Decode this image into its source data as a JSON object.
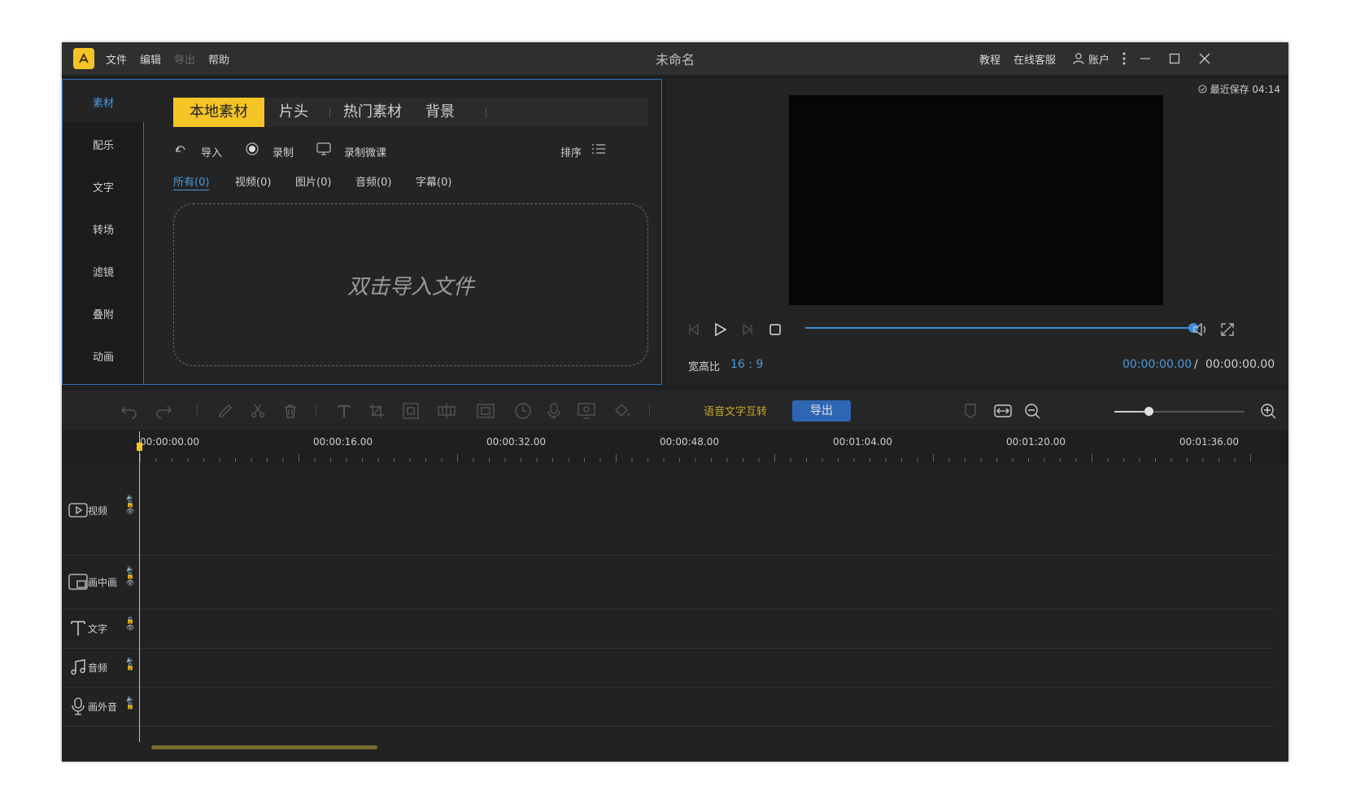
{
  "titlebar": {
    "menu": [
      "文件",
      "编辑",
      "导出",
      "帮助"
    ],
    "title": "未命名",
    "tutorial": "教程",
    "service": "在线客服",
    "account": "账户"
  },
  "sidebar": {
    "items": [
      {
        "label": "素材"
      },
      {
        "label": "配乐"
      },
      {
        "label": "文字"
      },
      {
        "label": "转场"
      },
      {
        "label": "滤镜"
      },
      {
        "label": "叠附"
      },
      {
        "label": "动画"
      }
    ]
  },
  "media": {
    "tabs": [
      {
        "label": "本地素材"
      },
      {
        "label": "片头"
      },
      {
        "label": "热门素材"
      },
      {
        "label": "背景"
      }
    ],
    "import_label": "导入",
    "record_label": "录制",
    "record_course_label": "录制微课",
    "sort_label": "排序",
    "filters": [
      {
        "label": "所有(0)"
      },
      {
        "label": "视频(0)"
      },
      {
        "label": "图片(0)"
      },
      {
        "label": "音频(0)"
      },
      {
        "label": "字幕(0)"
      }
    ],
    "drop_hint": "双击导入文件"
  },
  "preview": {
    "saved_text": "最近保存 04:14",
    "ratio_label": "宽高比",
    "ratio_value": "16 : 9",
    "current_time": "00:00:00.00",
    "separator": "/",
    "total_time": "00:00:00.00"
  },
  "toolbar": {
    "speech_text_label": "语音文字互转",
    "export_label": "导出"
  },
  "ruler": {
    "ticks": [
      "00:00:00.00",
      "00:00:16.00",
      "00:00:32.00",
      "00:00:48.00",
      "00:01:04.00",
      "00:01:20.00",
      "00:01:36.00"
    ]
  },
  "tracks": [
    {
      "label": "视频",
      "icon": "video-track-icon"
    },
    {
      "label": "画中画",
      "icon": "pip-track-icon"
    },
    {
      "label": "文字",
      "icon": "text-track-icon"
    },
    {
      "label": "音频",
      "icon": "music-track-icon"
    },
    {
      "label": "画外音",
      "icon": "mic-track-icon"
    }
  ],
  "colors": {
    "accent_yellow": "#f5c526",
    "accent_blue": "#4a9be0",
    "export_button": "#2e66b3"
  }
}
